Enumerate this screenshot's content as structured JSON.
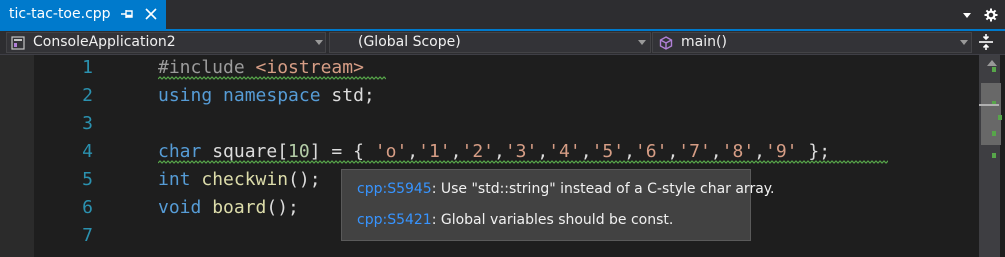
{
  "tab": {
    "title": "tic-tac-toe.cpp",
    "pin_icon": "pin-icon",
    "close_icon": "close-icon"
  },
  "strip_icons": [
    "dropdown-arrow-icon",
    "gear-icon"
  ],
  "navbar": {
    "project": "ConsoleApplication2",
    "scope": "(Global Scope)",
    "member": "main()"
  },
  "code_lines": [
    {
      "number": "1",
      "tokens": [
        {
          "t": "#include ",
          "k": "dir"
        },
        {
          "t": "<iostream>",
          "k": "inc"
        }
      ]
    },
    {
      "number": "2",
      "tokens": [
        {
          "t": "using ",
          "k": "kw"
        },
        {
          "t": "namespace ",
          "k": "kw"
        },
        {
          "t": "std;",
          "k": "txt"
        }
      ]
    },
    {
      "number": "3",
      "tokens": []
    },
    {
      "number": "4",
      "tokens": [
        {
          "t": "char ",
          "k": "kw"
        },
        {
          "t": "square[",
          "k": "txt"
        },
        {
          "t": "10",
          "k": "num"
        },
        {
          "t": "] = { ",
          "k": "txt"
        },
        {
          "t": "'o'",
          "k": "str"
        },
        {
          "t": ",",
          "k": "txt"
        },
        {
          "t": "'1'",
          "k": "str"
        },
        {
          "t": ",",
          "k": "txt"
        },
        {
          "t": "'2'",
          "k": "str"
        },
        {
          "t": ",",
          "k": "txt"
        },
        {
          "t": "'3'",
          "k": "str"
        },
        {
          "t": ",",
          "k": "txt"
        },
        {
          "t": "'4'",
          "k": "str"
        },
        {
          "t": ",",
          "k": "txt"
        },
        {
          "t": "'5'",
          "k": "str"
        },
        {
          "t": ",",
          "k": "txt"
        },
        {
          "t": "'6'",
          "k": "str"
        },
        {
          "t": ",",
          "k": "txt"
        },
        {
          "t": "'7'",
          "k": "str"
        },
        {
          "t": ",",
          "k": "txt"
        },
        {
          "t": "'8'",
          "k": "str"
        },
        {
          "t": ",",
          "k": "txt"
        },
        {
          "t": "'9'",
          "k": "str"
        },
        {
          "t": " };",
          "k": "txt"
        }
      ]
    },
    {
      "number": "5",
      "tokens": [
        {
          "t": "int ",
          "k": "kw"
        },
        {
          "t": "checkwin",
          "k": "fn"
        },
        {
          "t": "();",
          "k": "txt"
        }
      ]
    },
    {
      "number": "6",
      "tokens": [
        {
          "t": "void ",
          "k": "kw"
        },
        {
          "t": "board",
          "k": "fn"
        },
        {
          "t": "();",
          "k": "txt"
        }
      ]
    },
    {
      "number": "7",
      "tokens": []
    }
  ],
  "tooltip": {
    "rule1_id": "cpp:S5945",
    "rule1_text": ": Use \"std::string\" instead of a C-style char array.",
    "rule2_id": "cpp:S5421",
    "rule2_text": ": Global variables should be const."
  },
  "colors": {
    "accent": "#007acc",
    "line_number": "#2b91af",
    "keyword": "#569cd6",
    "string": "#d69d85",
    "squiggle": "#57a64a",
    "link": "#3794ff"
  }
}
